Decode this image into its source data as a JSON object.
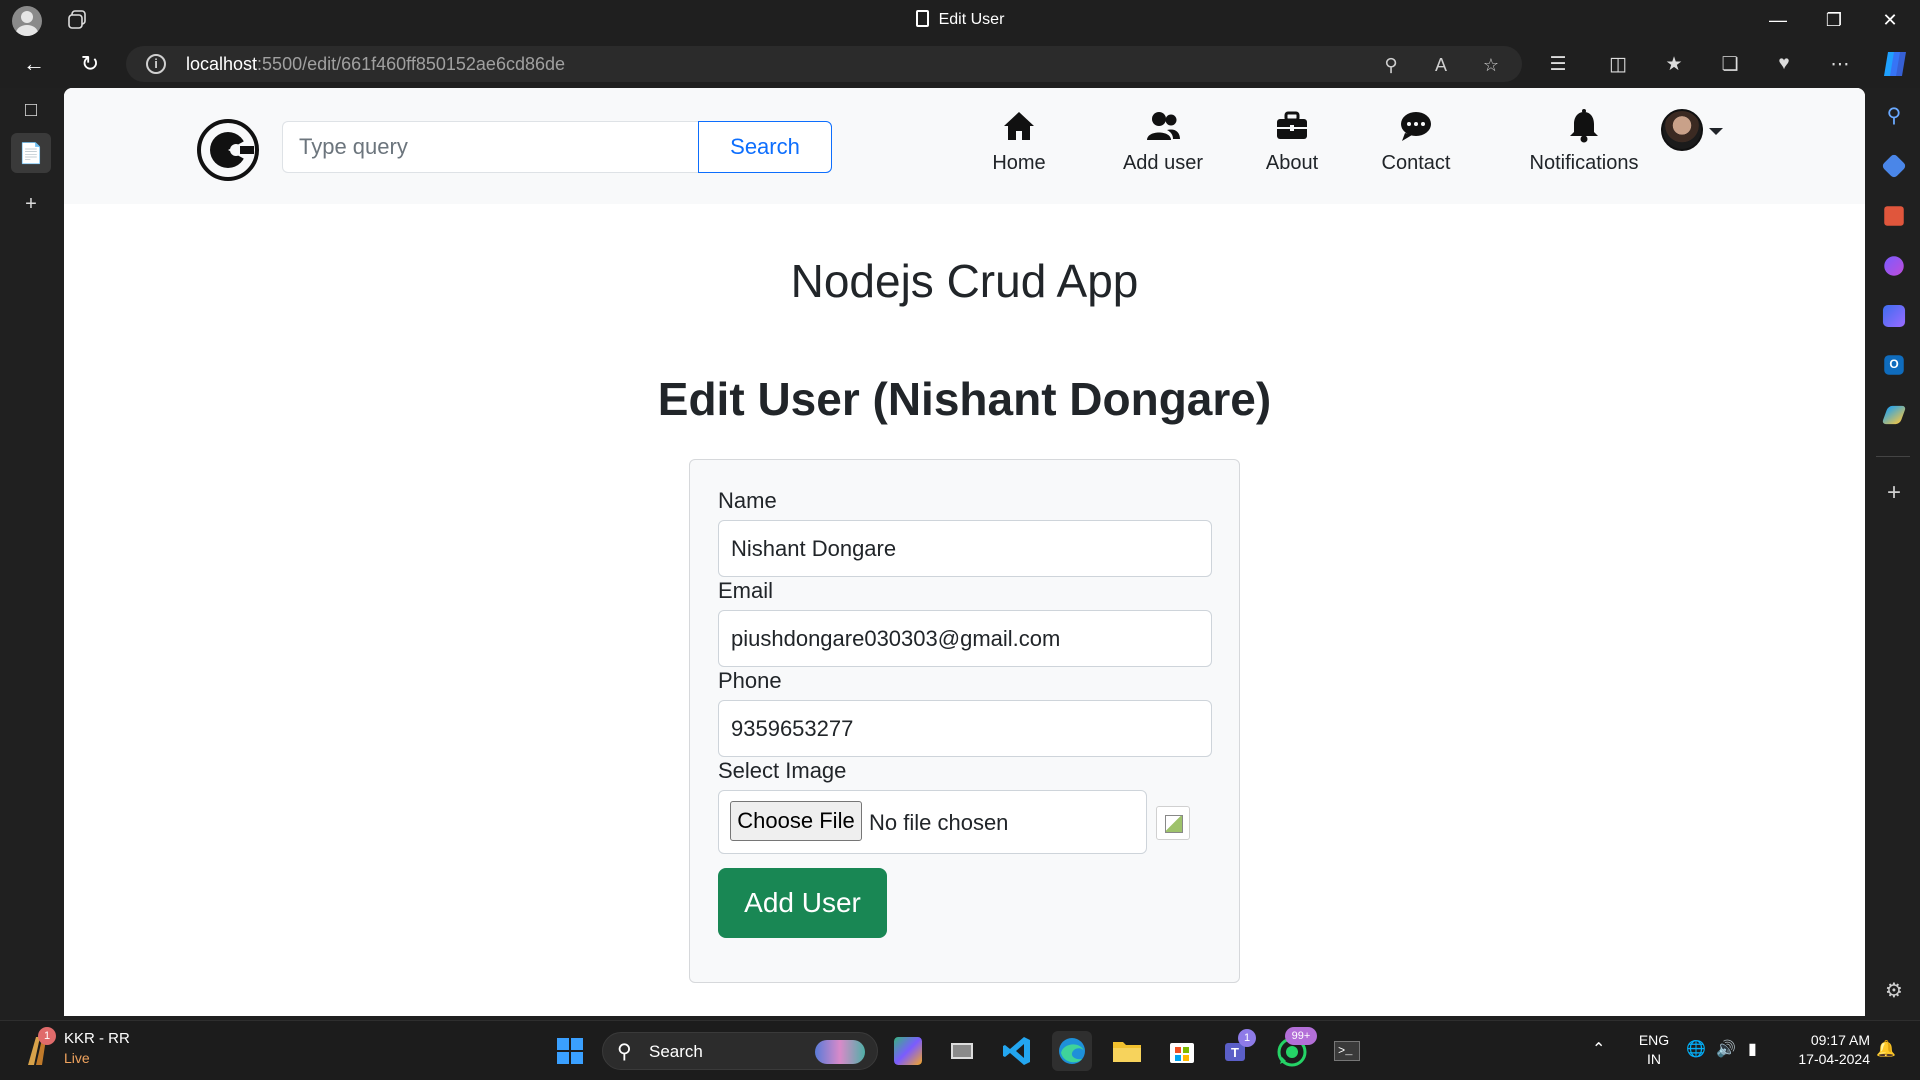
{
  "browser": {
    "tab_title": "Edit User",
    "url_host": "localhost",
    "url_path": ":5500/edit/661f460ff850152ae6cd86de"
  },
  "site": {
    "search_placeholder": "Type query",
    "search_button": "Search",
    "nav": [
      {
        "label": "Home",
        "icon": "home-icon"
      },
      {
        "label": "Add user",
        "icon": "users-icon"
      },
      {
        "label": "About",
        "icon": "briefcase-icon"
      },
      {
        "label": "Contact",
        "icon": "chat-icon"
      },
      {
        "label": "Notifications",
        "icon": "bell-icon"
      }
    ]
  },
  "main": {
    "app_title": "Nodejs Crud App",
    "page_title": "Edit User (Nishant Dongare)"
  },
  "form": {
    "name_label": "Name",
    "name_value": "Nishant Dongare",
    "email_label": "Email",
    "email_value": "piushdongare030303@gmail.com",
    "phone_label": "Phone",
    "phone_value": "9359653277",
    "image_label": "Select Image",
    "choose_file": "Choose File",
    "no_file": "No file chosen",
    "submit_label": "Add User"
  },
  "taskbar": {
    "widget_title": "KKR - RR",
    "widget_sub": "Live",
    "widget_badge": "1",
    "search_label": "Search",
    "teams_badge": "1",
    "whatsapp_badge": "99+",
    "lang_line1": "ENG",
    "lang_line2": "IN",
    "time": "09:17 AM",
    "date": "17-04-2024"
  },
  "colors": {
    "primary": "#0d6efd",
    "success": "#198754",
    "nav_bg": "#f8f9fa"
  }
}
